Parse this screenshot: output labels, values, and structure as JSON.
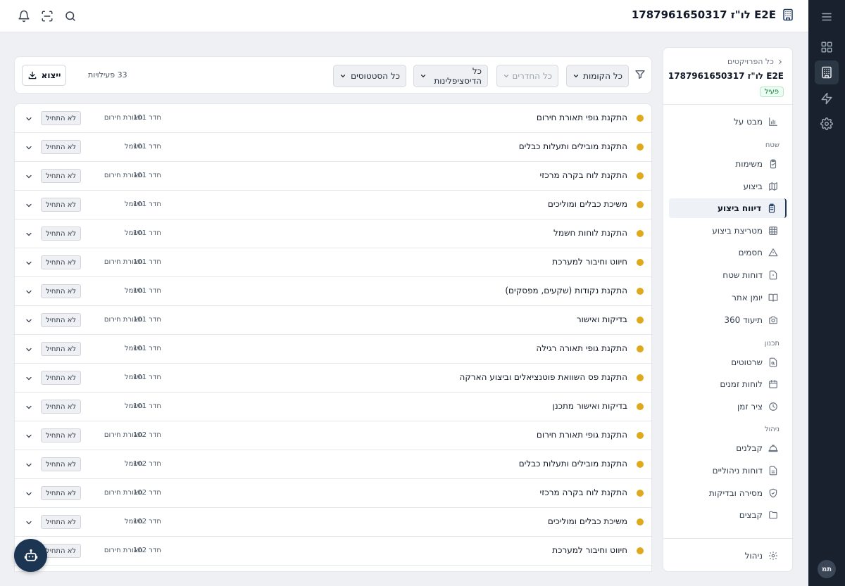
{
  "header": {
    "title": "E2E לו\"ז 1787961650317",
    "icons": [
      "building-icon",
      "search-icon",
      "scan-icon",
      "bell-icon"
    ]
  },
  "rail": {
    "icons": [
      "menu-icon",
      "grid-icon",
      "building-icon",
      "lightning-icon",
      "gear-icon"
    ],
    "avatar": "תמ"
  },
  "side": {
    "breadcrumb": "כל הפרויקטים",
    "project_name": "E2E לו\"ז 1787961650317",
    "status": "פעיל",
    "overview": "מבט על",
    "sections": {
      "field": "שטח",
      "planning": "תכנון",
      "management": "ניהול"
    },
    "field_items": [
      {
        "label": "משימות",
        "icon": "clipboard-icon"
      },
      {
        "label": "ביצוע",
        "icon": "map-icon"
      },
      {
        "label": "דיווח ביצוע",
        "icon": "clipboard-list-icon"
      },
      {
        "label": "מטריצת ביצוע",
        "icon": "grid-table-icon"
      },
      {
        "label": "חסמים",
        "icon": "warning-icon"
      },
      {
        "label": "דוחות שטח",
        "icon": "file-alert-icon"
      },
      {
        "label": "יומן אתר",
        "icon": "book-icon"
      },
      {
        "label": "תיעוד 360",
        "icon": "camera-icon"
      }
    ],
    "planning_items": [
      {
        "label": "שרטוטים",
        "icon": "file-search-icon"
      },
      {
        "label": "לוחות זמנים",
        "icon": "calendar-icon"
      },
      {
        "label": "ציר זמן",
        "icon": "clock-icon"
      }
    ],
    "management_items": [
      {
        "label": "קבלנים",
        "icon": "hard-hat-icon"
      },
      {
        "label": "דוחות ניהוליים",
        "icon": "report-icon"
      },
      {
        "label": "מסירה ובדיקות",
        "icon": "shield-check-icon"
      },
      {
        "label": "קבצים",
        "icon": "folder-icon"
      }
    ],
    "footer": {
      "label": "ניהול",
      "icon": "gear-icon"
    }
  },
  "filters": {
    "floors": "כל הקומות",
    "rooms": "כל החדרים",
    "disciplines": "כל הדיסציפלינות",
    "statuses": "כל הסטטוסים",
    "count": "33 פעילויות",
    "export": "ייצוא"
  },
  "rows": [
    {
      "title": "התקנת גופי תאורת חירום",
      "room": "חדר 101",
      "discipline": "תאורת חירום",
      "status": "לא התחיל"
    },
    {
      "title": "התקנת מובילים ותעלות כבלים",
      "room": "חדר 101",
      "discipline": "חשמל",
      "status": "לא התחיל"
    },
    {
      "title": "התקנת לוח בקרה מרכזי",
      "room": "חדר 101",
      "discipline": "תאורת חירום",
      "status": "לא התחיל"
    },
    {
      "title": "משיכת כבלים ומוליכים",
      "room": "חדר 101",
      "discipline": "חשמל",
      "status": "לא התחיל"
    },
    {
      "title": "התקנת לוחות חשמל",
      "room": "חדר 101",
      "discipline": "חשמל",
      "status": "לא התחיל"
    },
    {
      "title": "חיווט וחיבור למערכת",
      "room": "חדר 101",
      "discipline": "תאורת חירום",
      "status": "לא התחיל"
    },
    {
      "title": "התקנת נקודות (שקעים, מפסקים)",
      "room": "חדר 101",
      "discipline": "חשמל",
      "status": "לא התחיל"
    },
    {
      "title": "בדיקות ואישור",
      "room": "חדר 101",
      "discipline": "תאורת חירום",
      "status": "לא התחיל"
    },
    {
      "title": "התקנת גופי תאורה רגילה",
      "room": "חדר 101",
      "discipline": "חשמל",
      "status": "לא התחיל"
    },
    {
      "title": "התקנת פס השוואת פוטנציאלים וביצוע הארקה",
      "room": "חדר 101",
      "discipline": "חשמל",
      "status": "לא התחיל"
    },
    {
      "title": "בדיקות ואישור מתכנן",
      "room": "חדר 101",
      "discipline": "חשמל",
      "status": "לא התחיל"
    },
    {
      "title": "התקנת גופי תאורת חירום",
      "room": "חדר 102",
      "discipline": "תאורת חירום",
      "status": "לא התחיל"
    },
    {
      "title": "התקנת מובילים ותעלות כבלים",
      "room": "חדר 102",
      "discipline": "חשמל",
      "status": "לא התחיל"
    },
    {
      "title": "התקנת לוח בקרה מרכזי",
      "room": "חדר 102",
      "discipline": "תאורת חירום",
      "status": "לא התחיל"
    },
    {
      "title": "משיכת כבלים ומוליכים",
      "room": "חדר 102",
      "discipline": "חשמל",
      "status": "לא התחיל"
    },
    {
      "title": "חיווט וחיבור למערכת",
      "room": "חדר 102",
      "discipline": "תאורת חירום",
      "status": "לא התחיל"
    }
  ],
  "colors": {
    "accent": "#1e3a5f",
    "status_dot": "#e0a91c",
    "rail": "#18212d",
    "active_badge": "#15803d"
  }
}
